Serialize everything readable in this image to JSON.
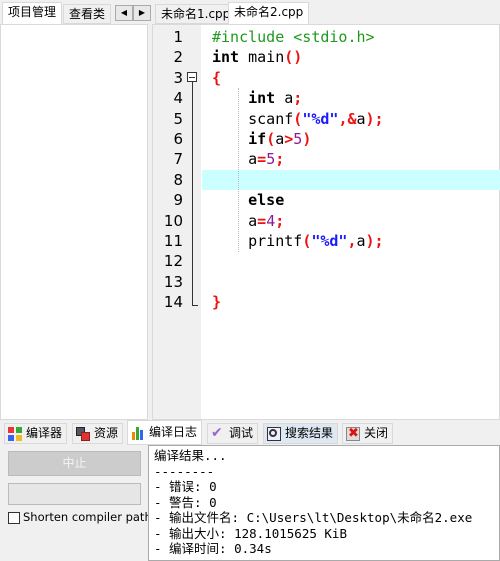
{
  "left_tabs": [
    "项目管理",
    "查看类"
  ],
  "editor_tabs": [
    "未命名1.cpp",
    "未命名2.cpp"
  ],
  "active_editor_tab": 1,
  "code_lines": [
    [
      [
        "#include <stdio.h>",
        "pp"
      ]
    ],
    [
      [
        "int",
        "kw"
      ],
      [
        " main",
        "id"
      ],
      [
        "()",
        "op"
      ]
    ],
    [
      [
        "{",
        "op"
      ]
    ],
    [
      [
        "    ",
        "id"
      ],
      [
        "int",
        "kw"
      ],
      [
        " a",
        "id"
      ],
      [
        ";",
        "op"
      ]
    ],
    [
      [
        "    scanf",
        "id"
      ],
      [
        "(",
        "op"
      ],
      [
        "\"%d\"",
        "str"
      ],
      [
        ",&",
        "op"
      ],
      [
        "a",
        "id"
      ],
      [
        ");",
        "op"
      ]
    ],
    [
      [
        "    ",
        "id"
      ],
      [
        "if",
        "kw"
      ],
      [
        "(",
        "op"
      ],
      [
        "a",
        "id"
      ],
      [
        ">",
        "op"
      ],
      [
        "5",
        "num"
      ],
      [
        ")",
        "op"
      ]
    ],
    [
      [
        "    a",
        "id"
      ],
      [
        "=",
        "op"
      ],
      [
        "5",
        "num"
      ],
      [
        ";",
        "op"
      ]
    ],
    [],
    [
      [
        "    ",
        "id"
      ],
      [
        "else",
        "kw"
      ]
    ],
    [
      [
        "    a",
        "id"
      ],
      [
        "=",
        "op"
      ],
      [
        "4",
        "num"
      ],
      [
        ";",
        "op"
      ]
    ],
    [
      [
        "    printf",
        "id"
      ],
      [
        "(",
        "op"
      ],
      [
        "\"%d\"",
        "str"
      ],
      [
        ",",
        "op"
      ],
      [
        "a",
        "id"
      ],
      [
        ");",
        "op"
      ]
    ],
    [],
    [],
    [
      [
        "}",
        "op"
      ]
    ]
  ],
  "current_line": 8,
  "bottom_tabs": [
    {
      "label": "编译器",
      "icon": "compiler-grid-icon"
    },
    {
      "label": "资源",
      "icon": "resources-icon"
    },
    {
      "label": "编译日志",
      "icon": "bar-chart-icon"
    },
    {
      "label": "调试",
      "icon": "checkmark-icon"
    },
    {
      "label": "搜索结果",
      "icon": "magnifier-icon"
    },
    {
      "label": "关闭",
      "icon": "close-icon"
    }
  ],
  "active_bottom_tab": 2,
  "abort_button": "中止",
  "shorten_paths_label": "Shorten compiler paths",
  "shorten_paths_checked": false,
  "output_lines": [
    "编译结果...",
    "--------",
    "- 错误: 0",
    "- 警告: 0",
    "- 输出文件名: C:\\Users\\lt\\Desktop\\未命名2.exe",
    "- 输出大小: 128.1015625 KiB",
    "- 编译时间: 0.34s"
  ]
}
